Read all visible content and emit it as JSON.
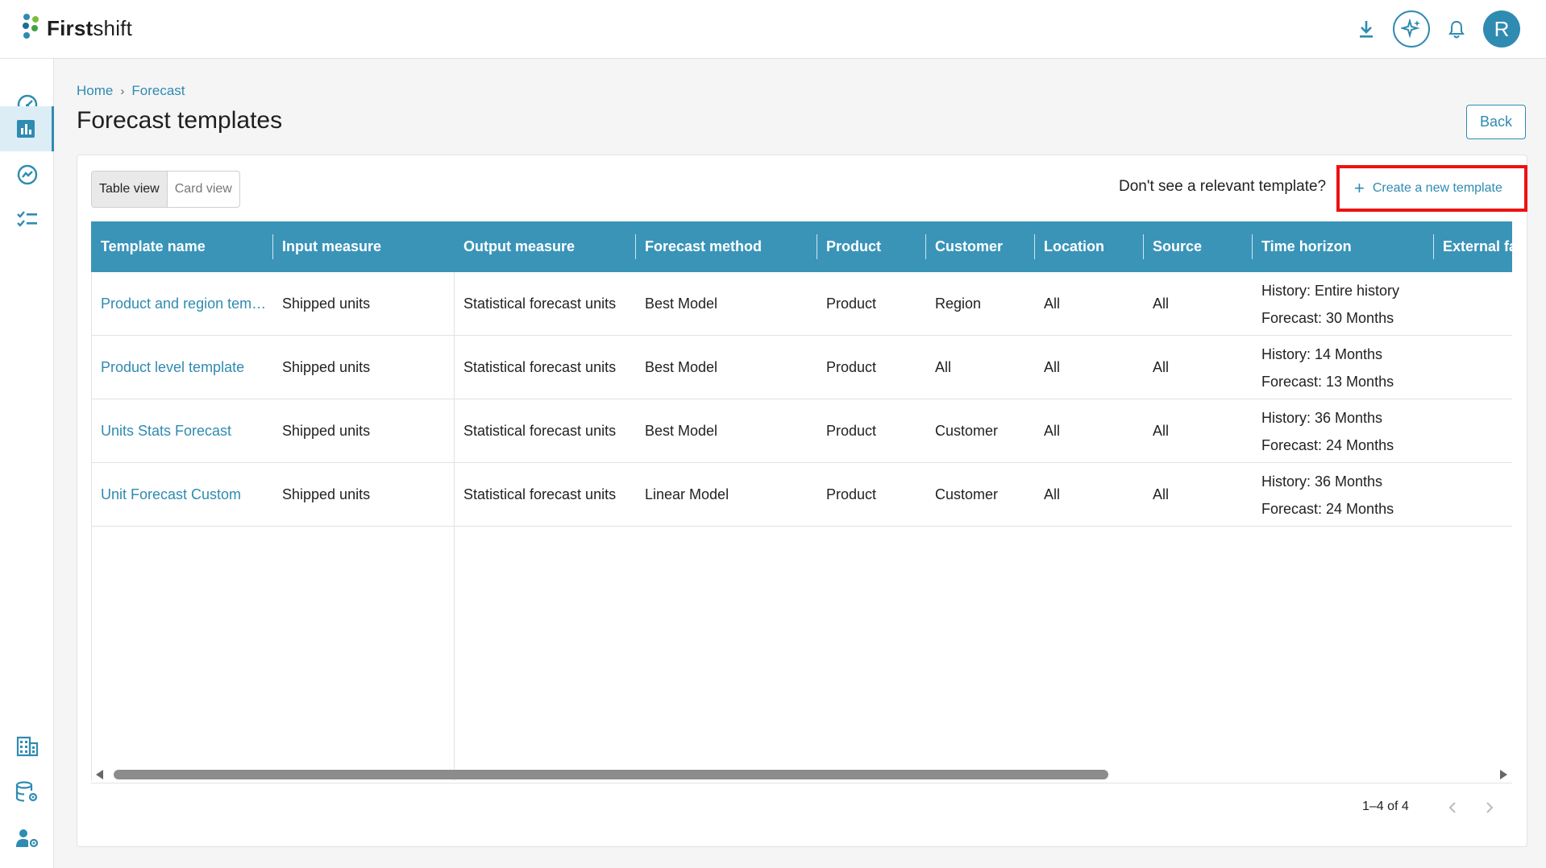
{
  "app": {
    "logo_bold": "First",
    "logo_light": "shift",
    "avatar_initial": "R"
  },
  "colors": {
    "accent": "#2f8bb1",
    "header_bg": "#3a94b8",
    "highlight": "#ee1111"
  },
  "top_icons": [
    "download-icon",
    "sparkle-ai-icon",
    "bell-icon"
  ],
  "sidebar": {
    "items": [
      {
        "icon": "speedometer-icon",
        "active": false
      },
      {
        "icon": "bar-chart-icon",
        "active": true
      },
      {
        "icon": "trend-icon",
        "active": false
      },
      {
        "icon": "checklist-icon",
        "active": false
      },
      {
        "icon": "building-icon",
        "active": false
      },
      {
        "icon": "database-settings-icon",
        "active": false
      },
      {
        "icon": "user-settings-icon",
        "active": false
      }
    ]
  },
  "breadcrumb": {
    "home": "Home",
    "current": "Forecast",
    "separator": "›"
  },
  "page": {
    "title": "Forecast templates",
    "back_label": "Back"
  },
  "view_toggle": {
    "table": "Table view",
    "card": "Card view"
  },
  "prompt": {
    "text": "Don't see a relevant template?",
    "create_label": "Create a new template",
    "create_icon": "plus-icon"
  },
  "table": {
    "columns": [
      "Template name",
      "Input measure",
      "Output measure",
      "Forecast method",
      "Product",
      "Customer",
      "Location",
      "Source",
      "Time horizon",
      "External fa"
    ],
    "rows": [
      {
        "name": "Product and region tem…",
        "input": "Shipped units",
        "output": "Statistical forecast units",
        "method": "Best Model",
        "product": "Product",
        "customer": "Region",
        "location": "All",
        "source": "All",
        "history": "History: Entire history",
        "forecast": "Forecast: 30 Months"
      },
      {
        "name": "Product level template",
        "input": "Shipped units",
        "output": "Statistical forecast units",
        "method": "Best Model",
        "product": "Product",
        "customer": "All",
        "location": "All",
        "source": "All",
        "history": "History: 14 Months",
        "forecast": "Forecast: 13 Months"
      },
      {
        "name": "Units Stats Forecast",
        "input": "Shipped units",
        "output": "Statistical forecast units",
        "method": "Best Model",
        "product": "Product",
        "customer": "Customer",
        "location": "All",
        "source": "All",
        "history": "History: 36 Months",
        "forecast": "Forecast: 24 Months"
      },
      {
        "name": "Unit Forecast Custom",
        "input": "Shipped units",
        "output": "Statistical forecast units",
        "method": "Linear Model",
        "product": "Product",
        "customer": "Customer",
        "location": "All",
        "source": "All",
        "history": "History: 36 Months",
        "forecast": "Forecast: 24 Months"
      }
    ]
  },
  "pagination": {
    "range": "1–4 of 4"
  }
}
